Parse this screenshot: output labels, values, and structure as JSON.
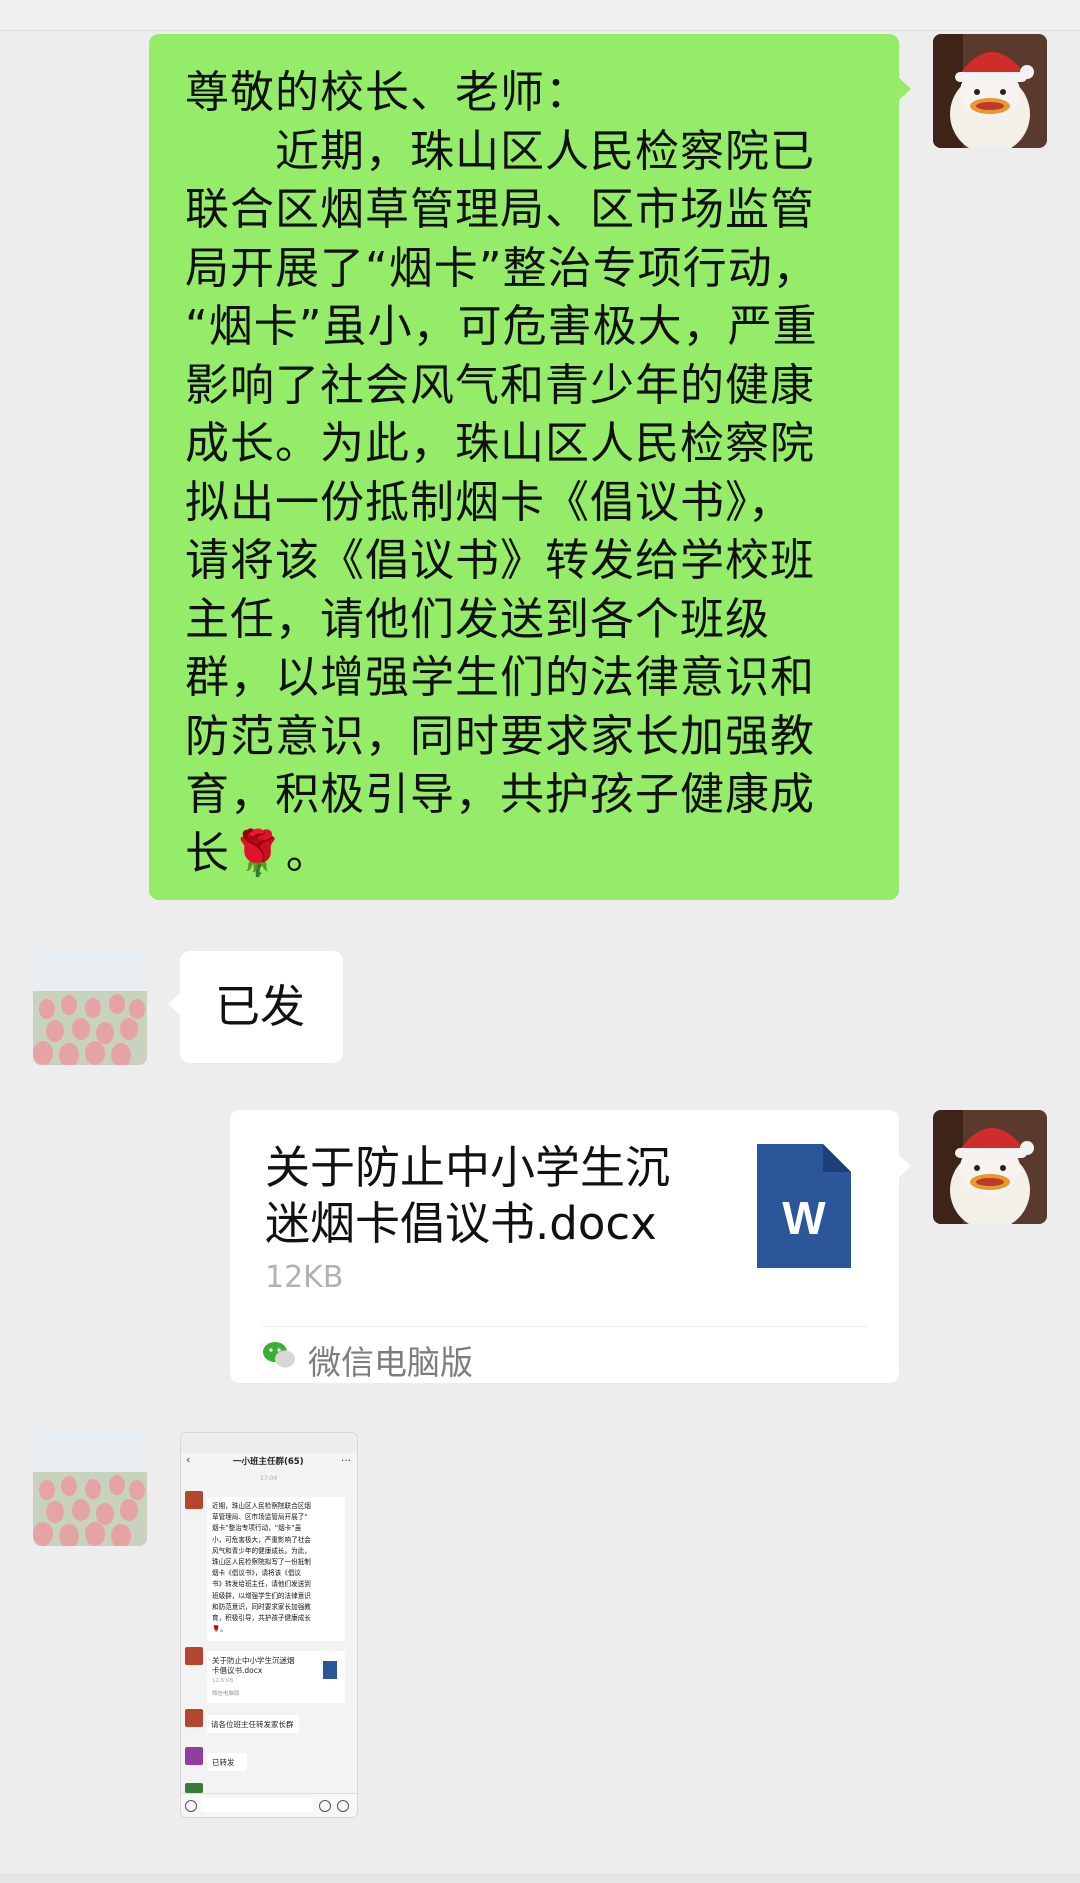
{
  "messages": [
    {
      "id": "m1",
      "direction": "outgoing",
      "type": "text",
      "lines": [
        "尊敬的校长、老师：",
        "　　近期，珠山区人民检察院已",
        "联合区烟草管理局、区市场监管",
        "局开展了“烟卡”整治专项行动，",
        "“烟卡”虽小，可危害极大，严重",
        "影响了社会风气和青少年的健康",
        "成长。为此，珠山区人民检察院",
        "拟出一份抵制烟卡《倡议书》，",
        "请将该《倡议书》转发给学校班",
        "主任，请他们发送到各个班级",
        "群，以增强学生们的法律意识和",
        "防范意识，同时要求家长加强教",
        "育，积极引导，共护孩子健康成",
        "长🌹。"
      ]
    },
    {
      "id": "m2",
      "direction": "incoming",
      "type": "text",
      "text": "已发"
    },
    {
      "id": "m3",
      "direction": "outgoing",
      "type": "file",
      "file_name_line1": "关于防止中小学生沉",
      "file_name_line2": "迷烟卡倡议书.docx",
      "file_size": "12KB",
      "file_icon": "word-doc-icon",
      "file_icon_letter": "W",
      "source": "微信电脑版",
      "source_icon": "wechat-logo-icon"
    },
    {
      "id": "m4",
      "direction": "incoming",
      "type": "image",
      "thumbnail": {
        "chat_title": "一小班主任群(65)",
        "time": "17:04",
        "msg1_lines": [
          "近期，珠山区人民检察院联合区烟",
          "草管理局、区市场监管局开展了“",
          "烟卡”整治专项行动，“烟卡”虽",
          "小，可危害极大，严重影响了社会",
          "风气和青少年的健康成长。为此，",
          "珠山区人民检察院拟写了一份抵制",
          "烟卡《倡议书》，请将该《倡议",
          "书》转发给班主任，请他们发送到",
          "班级群，以增强学生们的法律意识",
          "和防范意识，同时要求家长加强教",
          "育，积极引导，共护孩子健康成长",
          "🌹。"
        ],
        "file_line1": "关于防止中小学生沉迷烟",
        "file_line2": "卡倡议书.docx",
        "file_size": "12.6 KB",
        "file_source": "微信电脑版",
        "msg3": "请各位班主任转发家长群",
        "msg4": "已转发"
      }
    }
  ],
  "colors": {
    "outgoing_bubble": "#95ec69",
    "incoming_bubble": "#ffffff",
    "background": "#ededed",
    "word_blue": "#2b579a"
  }
}
